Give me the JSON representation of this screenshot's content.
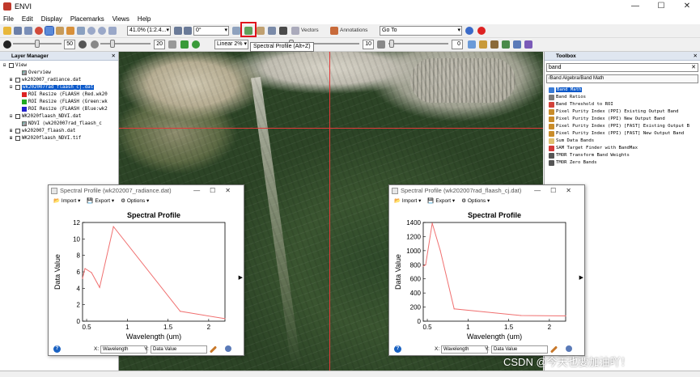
{
  "app": {
    "title": "ENVI",
    "window_controls": {
      "minimize": "—",
      "maximize": "☐",
      "close": "✕"
    }
  },
  "menu": [
    "File",
    "Edit",
    "Display",
    "Placemarks",
    "Views",
    "Help"
  ],
  "toolbar": {
    "zoom_value": "41.0% (1:2.4...",
    "rotation_value": "0°",
    "vectors_label": "Vectors",
    "annotations_label": "Annotations",
    "goto_value": "Go To",
    "brightness_value": "50",
    "contrast_value": "20",
    "stretch_value": "Linear 2%",
    "sharpen_value": "10",
    "transparency_value": "0",
    "tooltip": "Spectral Profile (Alt+Z)"
  },
  "layer_manager": {
    "title": "Layer Manager",
    "close": "✕",
    "items": [
      {
        "indent": 0,
        "toggle": "⊟",
        "label": "View",
        "selected": false,
        "icon": "box"
      },
      {
        "indent": 2,
        "toggle": "",
        "label": "Overview",
        "selected": false,
        "icon": "img"
      },
      {
        "indent": 1,
        "toggle": "⊞",
        "label": "wk202007_radiance.dat",
        "selected": false,
        "icon": "box"
      },
      {
        "indent": 1,
        "toggle": "⊟",
        "label": "wk202007rad_flaash_cj.dat",
        "selected": true,
        "icon": "box"
      },
      {
        "indent": 2,
        "toggle": "",
        "label": "ROI Resize (FLAASH (Red.wk20",
        "selected": false,
        "icon": "red"
      },
      {
        "indent": 2,
        "toggle": "",
        "label": "ROI Resize (FLAASH (Green:wk",
        "selected": false,
        "icon": "green"
      },
      {
        "indent": 2,
        "toggle": "",
        "label": "ROI Resize (FLAASH (Blue:wk2",
        "selected": false,
        "icon": "blue"
      },
      {
        "indent": 1,
        "toggle": "⊟",
        "label": "WK2020flaash_NDVI.dat",
        "selected": false,
        "icon": "box"
      },
      {
        "indent": 2,
        "toggle": "",
        "label": "NDVI (wk202007rad_flaash_c",
        "selected": false,
        "icon": "img"
      },
      {
        "indent": 1,
        "toggle": "⊞",
        "label": "wk202007_flaash.dat",
        "selected": false,
        "icon": "box"
      },
      {
        "indent": 1,
        "toggle": "⊞",
        "label": "WK2020flaash_NDVI.tif",
        "selected": false,
        "icon": "box"
      }
    ]
  },
  "toolbox": {
    "title": "Toolbox",
    "close": "✕",
    "search_value": "band",
    "path": "/Band Algebra/Band Math",
    "items": [
      {
        "label": "Band Math",
        "selected": true,
        "color": "#3a7bd5"
      },
      {
        "label": "Band Ratios",
        "selected": false,
        "color": "#7a7a7a"
      },
      {
        "label": "Band Threshold to ROI",
        "selected": false,
        "color": "#d2423a"
      },
      {
        "label": "Pixel Purity Index (PPI) Existing Output Band",
        "selected": false,
        "color": "#c98c2a"
      },
      {
        "label": "Pixel Purity Index (PPI) New Output Band",
        "selected": false,
        "color": "#c98c2a"
      },
      {
        "label": "Pixel Purity Index (PPI) [FAST] Existing Output B",
        "selected": false,
        "color": "#c98c2a"
      },
      {
        "label": "Pixel Purity Index (PPI) [FAST] New Output Band",
        "selected": false,
        "color": "#c98c2a"
      },
      {
        "label": "Sum Data Bands",
        "selected": false,
        "color": "#e0c070"
      },
      {
        "label": "SAM Target Finder with BandMax",
        "selected": false,
        "color": "#d23a3a"
      },
      {
        "label": "TMOR Transform Band Weights",
        "selected": false,
        "color": "#555555"
      },
      {
        "label": "TMOR Zero Bands",
        "selected": false,
        "color": "#555555"
      }
    ]
  },
  "spectral_windows": [
    {
      "window_title": "Spectral Profile (wk202007_radiance.dat)",
      "menu": {
        "import": "Import",
        "export": "Export",
        "options": "Options"
      },
      "footer": {
        "x_label": "X:",
        "x_value": "Wavelength",
        "y_label": "Y:",
        "y_value": "Data Value"
      },
      "help": "?",
      "arrow": "▶"
    },
    {
      "window_title": "Spectral Profile (wk202007rad_flaash_cj.dat)",
      "menu": {
        "import": "Import",
        "export": "Export",
        "options": "Options"
      },
      "footer": {
        "x_label": "X:",
        "x_value": "Wavelength",
        "y_label": "Y:",
        "y_value": "Data Value"
      },
      "help": "?",
      "arrow": "▶"
    }
  ],
  "chart_data": [
    {
      "type": "line",
      "title": "Spectral Profile",
      "xlabel": "Wavelength (um)",
      "ylabel": "Data Value",
      "xlim": [
        0.45,
        2.2
      ],
      "ylim": [
        0,
        12
      ],
      "xticks": [
        0.5,
        1.0,
        1.5,
        2.0
      ],
      "yticks": [
        0,
        2,
        4,
        6,
        8,
        10,
        12
      ],
      "line_color": "#f07070",
      "series": [
        {
          "x": [
            0.45,
            0.48,
            0.56,
            0.66,
            0.83,
            1.65,
            2.2
          ],
          "y": [
            5.2,
            6.4,
            5.9,
            4.1,
            11.5,
            1.2,
            0.3
          ]
        }
      ]
    },
    {
      "type": "line",
      "title": "Spectral Profile",
      "xlabel": "Wavelength (um)",
      "ylabel": "Data Value",
      "xlim": [
        0.45,
        2.2
      ],
      "ylim": [
        0,
        1400
      ],
      "xticks": [
        0.5,
        1.0,
        1.5,
        2.0
      ],
      "yticks": [
        0,
        200,
        400,
        600,
        800,
        1000,
        1200,
        1400
      ],
      "line_color": "#f07070",
      "series": [
        {
          "x": [
            0.45,
            0.48,
            0.56,
            0.66,
            0.83,
            1.65,
            2.2
          ],
          "y": [
            780,
            800,
            1390,
            1000,
            175,
            80,
            75
          ]
        }
      ]
    }
  ],
  "watermark": "CSDN @今天也要加油吖！"
}
